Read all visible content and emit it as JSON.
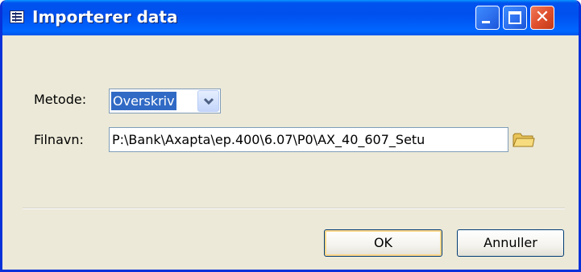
{
  "window": {
    "title": "Importerer data",
    "close_glyph": "✕"
  },
  "form": {
    "method_label": "Metode:",
    "method_value": "Overskriv",
    "filename_label": "Filnavn:",
    "filename_value": "P:\\Bank\\Axapta\\ep.400\\6.07\\P0\\AX_40_607_Setu"
  },
  "buttons": {
    "ok_label": "OK",
    "cancel_label": "Annuller"
  },
  "icons": {
    "title": "form-icon",
    "browse": "folder-icon",
    "dropdown": "chevron-down-icon"
  },
  "colors": {
    "titlebar": "#0054e3",
    "dialog_bg": "#ece9d8",
    "selection": "#316ac5",
    "close_button": "#e0502e"
  }
}
